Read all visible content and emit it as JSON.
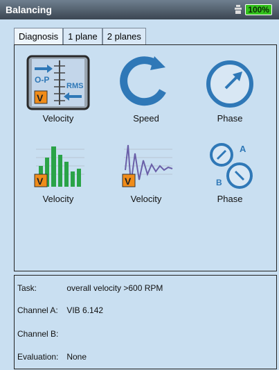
{
  "window": {
    "title": "Balancing",
    "battery": "100%"
  },
  "tabs": [
    {
      "label": "Diagnosis"
    },
    {
      "label": "1 plane"
    },
    {
      "label": "2 planes"
    }
  ],
  "tiles": [
    {
      "label": "Velocity"
    },
    {
      "label": "Speed"
    },
    {
      "label": "Phase"
    },
    {
      "label": "Velocity"
    },
    {
      "label": "Velocity"
    },
    {
      "label": "Phase"
    }
  ],
  "icon_text": {
    "op": "O-P",
    "rms": "RMS",
    "v": "V",
    "a": "A",
    "b": "B"
  },
  "info": {
    "task": {
      "key": "Task:",
      "value": "overall velocity >600 RPM"
    },
    "channel_a": {
      "key": "Channel A:",
      "value": "VIB 6.142"
    },
    "channel_b": {
      "key": "Channel B:",
      "value": ""
    },
    "evaluation": {
      "key": "Evaluation:",
      "value": "None"
    }
  },
  "colors": {
    "accent_green": "#34c21d",
    "blue": "#2f78b7",
    "orange": "#f08c1a"
  }
}
